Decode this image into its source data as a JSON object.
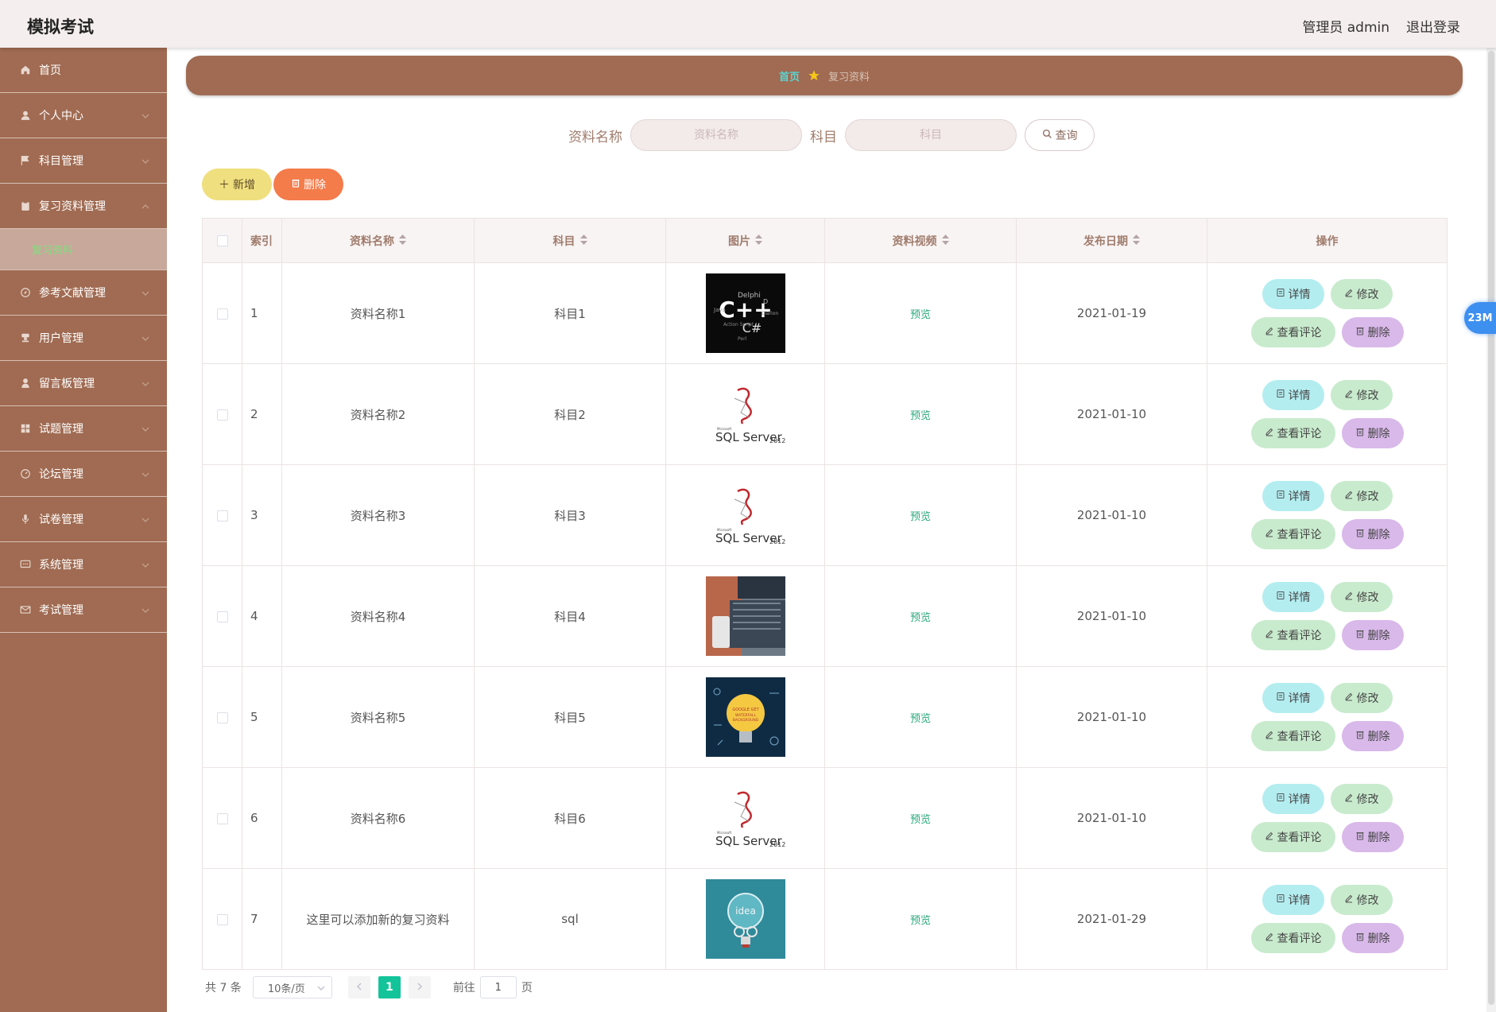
{
  "header": {
    "brand": "模拟考试",
    "admin": "管理员 admin",
    "logout": "退出登录"
  },
  "sidebar": {
    "items": [
      {
        "label": "首页",
        "icon": "home-icon"
      },
      {
        "label": "个人中心",
        "icon": "user-icon"
      },
      {
        "label": "科目管理",
        "icon": "flag-icon"
      },
      {
        "label": "复习资料管理",
        "icon": "clipboard-icon"
      },
      {
        "label": "参考文献管理",
        "icon": "compass-icon"
      },
      {
        "label": "用户管理",
        "icon": "stamp-icon"
      },
      {
        "label": "留言板管理",
        "icon": "person-icon"
      },
      {
        "label": "试题管理",
        "icon": "grid-icon"
      },
      {
        "label": "论坛管理",
        "icon": "dashboard-icon"
      },
      {
        "label": "试卷管理",
        "icon": "mic-icon"
      },
      {
        "label": "系统管理",
        "icon": "chat-icon"
      },
      {
        "label": "考试管理",
        "icon": "mail-icon"
      }
    ],
    "submenu_active": "复习资料"
  },
  "breadcrumb": {
    "home": "首页",
    "current": "复习资料"
  },
  "search": {
    "name_label": "资料名称",
    "name_placeholder": "资料名称",
    "subject_label": "科目",
    "subject_placeholder": "科目",
    "query_button": "查询"
  },
  "actions": {
    "add": "新增",
    "delete": "删除"
  },
  "table": {
    "headers": {
      "index": "索引",
      "name": "资料名称",
      "subject": "科目",
      "image": "图片",
      "video": "资料视频",
      "date": "发布日期",
      "ops": "操作"
    },
    "rows": [
      {
        "index": "1",
        "name": "资料名称1",
        "subject": "科目1",
        "image": "cpp-wordcloud",
        "video": "预览",
        "date": "2021-01-19"
      },
      {
        "index": "2",
        "name": "资料名称2",
        "subject": "科目2",
        "image": "sql-server-2012",
        "video": "预览",
        "date": "2021-01-10"
      },
      {
        "index": "3",
        "name": "资料名称3",
        "subject": "科目3",
        "image": "sql-server-2012",
        "video": "预览",
        "date": "2021-01-10"
      },
      {
        "index": "4",
        "name": "资料名称4",
        "subject": "科目4",
        "image": "laptop-photo",
        "video": "预览",
        "date": "2021-01-10"
      },
      {
        "index": "5",
        "name": "资料名称5",
        "subject": "科目5",
        "image": "lightbulb-doodle",
        "video": "预览",
        "date": "2021-01-10"
      },
      {
        "index": "6",
        "name": "资料名称6",
        "subject": "科目6",
        "image": "sql-server-2012",
        "video": "预览",
        "date": "2021-01-10"
      },
      {
        "index": "7",
        "name": "这里可以添加新的复习资料",
        "subject": "sql",
        "image": "idea-bulb",
        "video": "预览",
        "date": "2021-01-29"
      }
    ],
    "op_labels": {
      "detail": "详情",
      "edit": "修改",
      "comment": "查看评论",
      "delete": "删除"
    }
  },
  "pagination": {
    "total": "共 7 条",
    "page_size": "10条/页",
    "current": "1",
    "goto_prefix": "前往",
    "goto_value": "1",
    "goto_suffix": "页"
  },
  "float_badge": "23M",
  "colors": {
    "sidebar": "#a06b52",
    "accent_green": "#13c49a",
    "delete_orange": "#f47b4a",
    "add_yellow": "#f0df7e"
  }
}
